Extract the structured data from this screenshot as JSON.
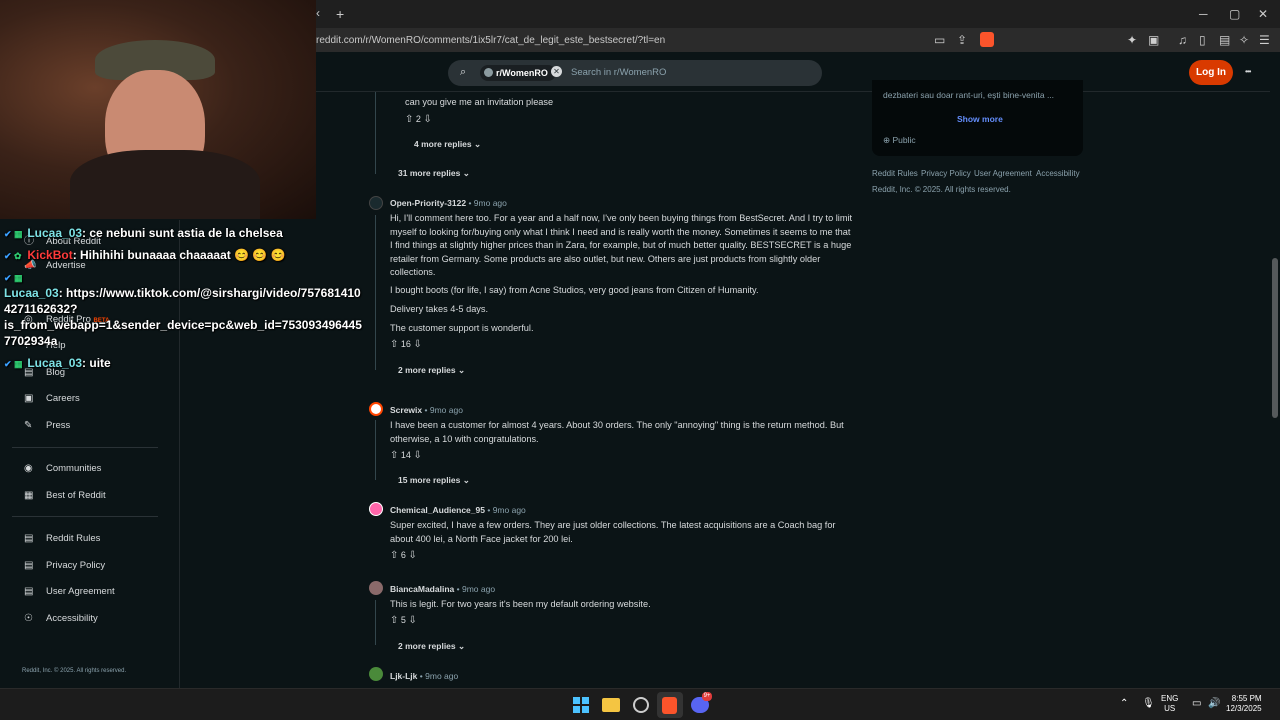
{
  "browser": {
    "new_tab": "+",
    "url": "reddit.com/r/WomenRO/comments/1ix5lr7/cat_de_legit_este_bestsecret/?tl=en",
    "win_minimize": "─",
    "win_maximize": "▢",
    "win_close": "✕",
    "tab_back": "‹"
  },
  "header": {
    "subreddit_chip": "r/WomenRO",
    "search_placeholder": "Search in r/WomenRO",
    "login": "Log In",
    "more": "•••"
  },
  "sidebar": {
    "items_top": [
      {
        "icon": "info-icon",
        "glyph": "ⓘ",
        "label": "About Reddit"
      },
      {
        "icon": "megaphone-icon",
        "glyph": "📣",
        "label": "Advertise"
      },
      {
        "icon": "pro-icon",
        "glyph": "◎",
        "label": "Reddit Pro",
        "badge": "BETA"
      },
      {
        "icon": "help-icon",
        "glyph": "?",
        "label": "Help"
      },
      {
        "icon": "book-icon",
        "glyph": "▤",
        "label": "Blog"
      },
      {
        "icon": "briefcase-icon",
        "glyph": "▣",
        "label": "Careers"
      },
      {
        "icon": "press-icon",
        "glyph": "✎",
        "label": "Press"
      }
    ],
    "items_mid": [
      {
        "icon": "communities-icon",
        "glyph": "◉",
        "label": "Communities"
      },
      {
        "icon": "best-icon",
        "glyph": "▦",
        "label": "Best of Reddit"
      }
    ],
    "items_bottom": [
      {
        "icon": "rules-icon",
        "glyph": "▤",
        "label": "Reddit Rules"
      },
      {
        "icon": "privacy-icon",
        "glyph": "▤",
        "label": "Privacy Policy"
      },
      {
        "icon": "agreement-icon",
        "glyph": "▤",
        "label": "User Agreement"
      },
      {
        "icon": "accessibility-icon",
        "glyph": "☉",
        "label": "Accessibility"
      }
    ],
    "copyright": "Reddit, Inc. © 2025. All rights reserved."
  },
  "chat": [
    {
      "user": "Lucaa_03",
      "text": ": ce nebuni sunt astia de la chelsea"
    },
    {
      "user": "KickBot",
      "text": ": Hihihihi bunaaaa chaaaaat 😊 😊 😊"
    },
    {
      "user": "Lucaa_03",
      "text": ": https://www.tiktok.com/@sirshargi/video/757681410"
    },
    {
      "line": "4271162632?"
    },
    {
      "line": "is_from_webapp=1&sender_device=pc&web_id=753093496445"
    },
    {
      "line": "7702934a"
    },
    {
      "user": "Lucaa_03",
      "text": ": uite"
    }
  ],
  "comments": {
    "top_reply_text": "can you give me an invitation please",
    "top_reply_votes": "2",
    "more_replies_4": "4 more replies",
    "more_replies_31": "31 more replies",
    "c1": {
      "user": "Open-Priority-3122",
      "time": "9mo ago",
      "p1": "Hi, I'll comment here too. For a year and a half now, I've only been buying things from BestSecret. And I try to limit myself to looking for/buying only what I think I need and is really worth the money. Sometimes it seems to me that I find things at slightly higher prices than in Zara, for example, but of much better quality. BESTSECRET is a huge retailer from Germany. Some products are also outlet, but new. Others are just products from slightly older collections.",
      "p2": "I bought boots (for life, I say) from Acne Studios, very good jeans from Citizen of Humanity.",
      "p3": "Delivery takes 4-5 days.",
      "p4": "The customer support is wonderful.",
      "votes": "16",
      "more": "2 more replies"
    },
    "c2": {
      "user": "Screwix",
      "time": "9mo ago",
      "text": "I have been a customer for almost 4 years. About 30 orders. The only \"annoying\" thing is the return method. But otherwise, a 10 with congratulations.",
      "votes": "14",
      "more": "15 more replies"
    },
    "c3": {
      "user": "Chemical_Audience_95",
      "time": "9mo ago",
      "text": "Super excited, I have a few orders. They are just older collections. The latest acquisitions are a Coach bag for about 400 lei, a North Face jacket for 200 lei.",
      "votes": "6"
    },
    "c4": {
      "user": "BiancaMadalina",
      "time": "9mo ago",
      "text": "This is legit. For two years it's been my default ordering website.",
      "votes": "5",
      "more": "2 more replies"
    },
    "c5": {
      "user": "Ljk-Ljk",
      "time": "9mo ago"
    },
    "sep": "•"
  },
  "right": {
    "desc": "dezbateri sau doar rant-uri, ești bine-venita ...",
    "show_more": "Show more",
    "public": "Public",
    "links": [
      "Reddit Rules",
      "Privacy Policy",
      "User Agreement",
      "Accessibility"
    ],
    "copyright": "Reddit, Inc. © 2025. All rights reserved."
  },
  "taskbar": {
    "lang1": "ENG",
    "lang2": "US",
    "time": "8:55 PM",
    "date": "12/3/2025",
    "discord_badge": "9+"
  },
  "colors": {
    "login_bg": "#d93a00",
    "show_more": "#648efc",
    "chat_user": "#7ee3e6",
    "kickbot": "#ff3b3b"
  }
}
